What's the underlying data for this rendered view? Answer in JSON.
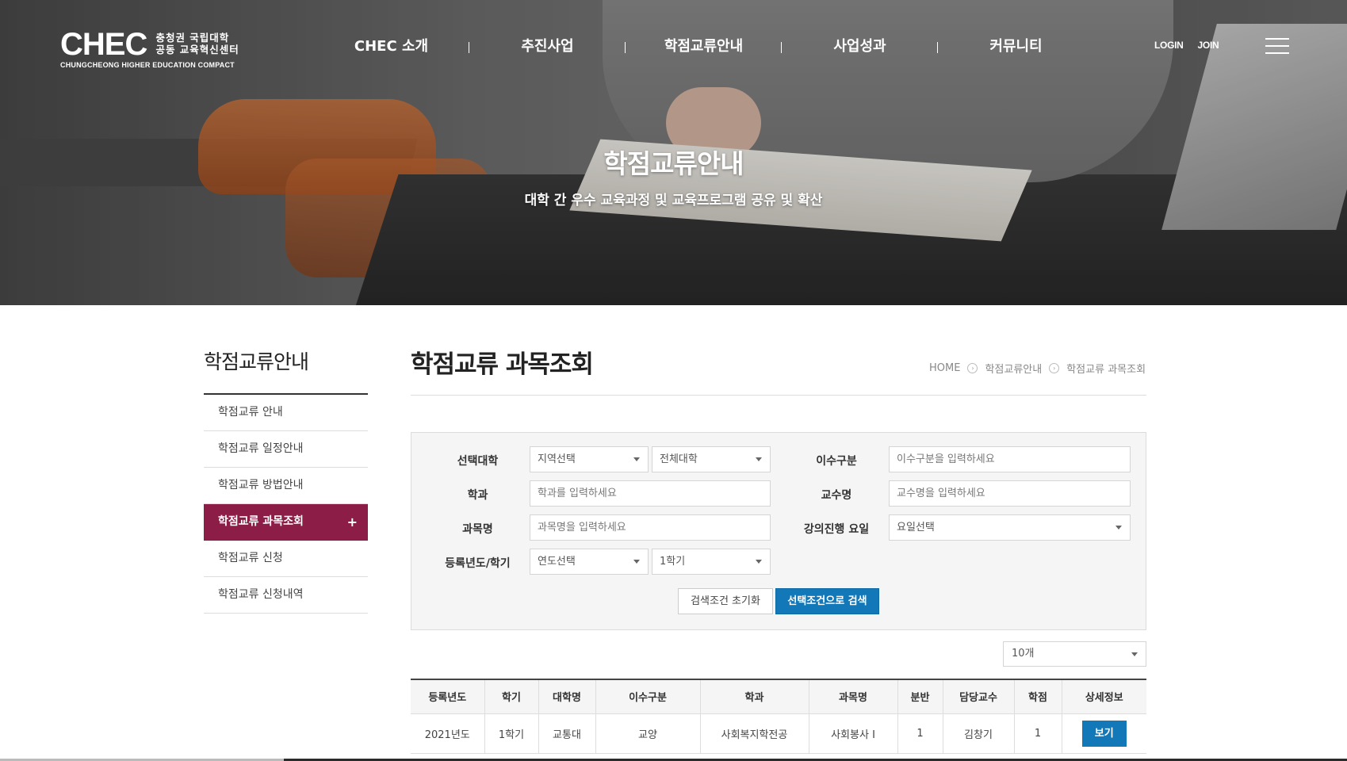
{
  "logo": {
    "mark": "CHEC",
    "ko_line1": "충청권 국립대학",
    "ko_line2": "공동 교육혁신센터",
    "en": "CHUNGCHEONG HIGHER EDUCATION COMPACT"
  },
  "gnb": [
    "CHEC 소개",
    "추진사업",
    "학점교류안내",
    "사업성과",
    "커뮤니티"
  ],
  "util": {
    "login": "LOGIN",
    "join": "JOIN"
  },
  "hero": {
    "title": "학점교류안내",
    "subtitle": "대학 간 우수 교육과정 및 교육프로그램 공유 및 확산"
  },
  "sidebar": {
    "title": "학점교류안내",
    "items": [
      {
        "label": "학점교류 안내"
      },
      {
        "label": "학점교류 일정안내"
      },
      {
        "label": "학점교류 방법안내"
      },
      {
        "label": "학점교류 과목조회",
        "active": true
      },
      {
        "label": "학점교류 신청"
      },
      {
        "label": "학점교류 신청내역"
      }
    ],
    "active_mark": "+"
  },
  "content": {
    "title": "학점교류 과목조회",
    "breadcrumb": [
      "HOME",
      "학점교류안내",
      "학점교류 과목조회"
    ],
    "breadcrumb_arrow": "›"
  },
  "search": {
    "labels": {
      "university": "선택대학",
      "dept": "학과",
      "subject": "과목명",
      "year_term": "등록년도/학기",
      "category": "이수구분",
      "professor": "교수명",
      "weekday": "강의진행 요일"
    },
    "region_select": "지역선택",
    "univ_select": "전체대학",
    "dept_placeholder": "학과를 입력하세요",
    "subject_placeholder": "과목명을 입력하세요",
    "year_select": "연도선택",
    "term_select": "1학기",
    "category_placeholder": "이수구분을 입력하세요",
    "professor_placeholder": "교수명을 입력하세요",
    "weekday_select": "요일선택",
    "reset_label": "검색조건 초기화",
    "search_label": "선택조건으로 검색"
  },
  "per_page": "10개",
  "table": {
    "headers": [
      "등록년도",
      "학기",
      "대학명",
      "이수구분",
      "학과",
      "과목명",
      "분반",
      "담당교수",
      "학점",
      "상세정보"
    ],
    "rows": [
      [
        "2021년도",
        "1학기",
        "교통대",
        "교양",
        "사회복지학전공",
        "사회봉사 Ⅰ",
        "1",
        "김창기",
        "1",
        "보기"
      ]
    ]
  },
  "colors": {
    "accent": "#8c1d46",
    "primary_button": "#1278b8"
  }
}
